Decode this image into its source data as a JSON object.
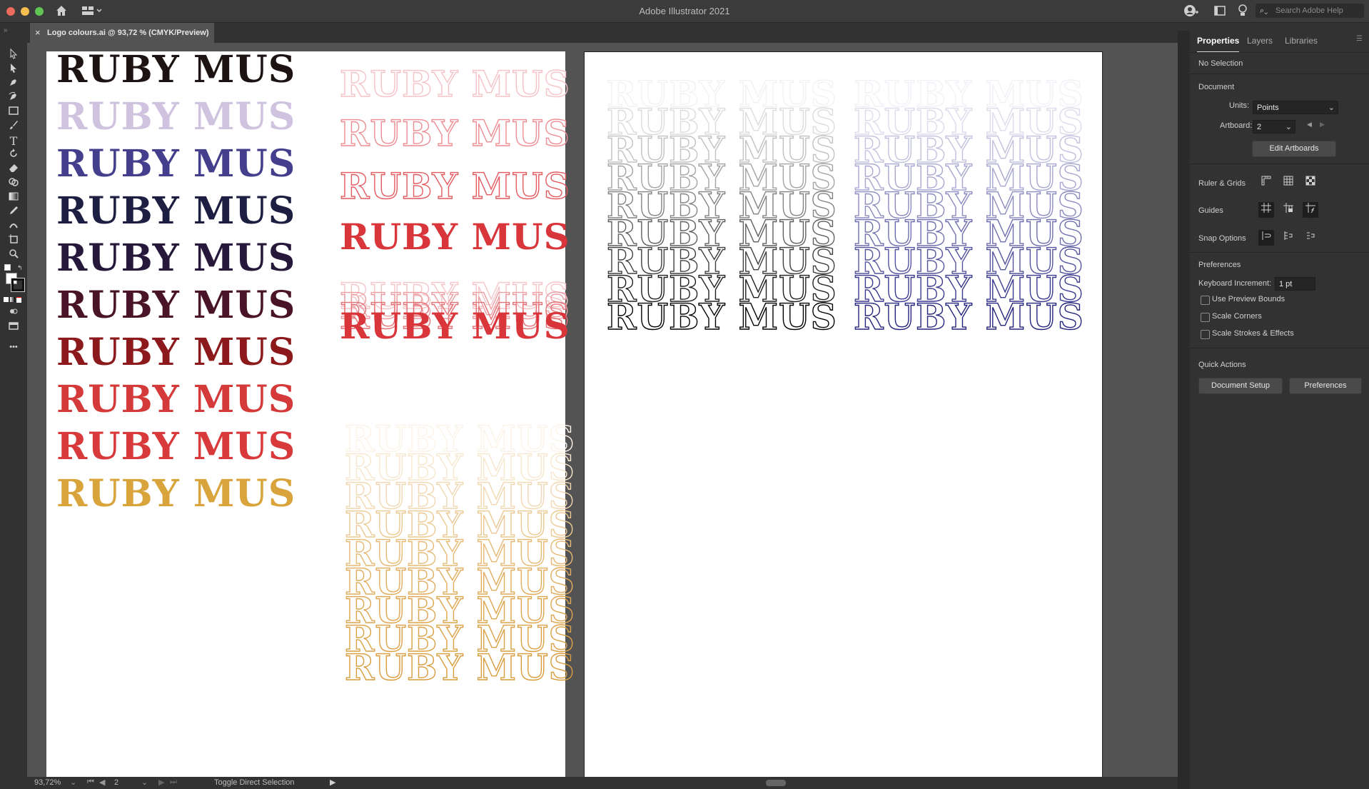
{
  "window": {
    "title": "Adobe Illustrator 2021",
    "search_placeholder": "Search Adobe Help"
  },
  "document_tab": {
    "label": "Logo colours.ai @ 93,72 % (CMYK/Preview)",
    "close_glyph": "×"
  },
  "toolbar": {
    "tools": [
      "selection-tool",
      "direct-selection-tool",
      "pen-tool",
      "curvature-tool",
      "rectangle-tool",
      "paintbrush-tool",
      "type-tool",
      "rotate-tool",
      "eraser-tool",
      "shape-builder-tool",
      "gradient-tool",
      "eyedropper-tool",
      "puppet-warp-tool",
      "artboard-tool",
      "zoom-tool"
    ],
    "more_glyph": "•••"
  },
  "artwork": {
    "text": "RUBY MUS",
    "left_column_colors": [
      "#1c1312",
      "#cfc3df",
      "#443f8c",
      "#1d1f42",
      "#26183b",
      "#4a1428",
      "#8c1a1c",
      "#d53a3a",
      "#d83a3c",
      "#d8a43b"
    ],
    "red_column_colors": [
      "#f5c3c7",
      "#ec8e93",
      "#e35a5f",
      "#d8363b"
    ],
    "red_stack_colors": [
      "#f4c6c9",
      "#ec9ea2",
      "#e47176",
      "#d8363b"
    ],
    "gold_stack_colors": [
      "#fbf3e7",
      "#f7e7cf",
      "#f1d8b2",
      "#ecc992",
      "#e6b975",
      "#e1ac5d",
      "#dea54f",
      "#dba146",
      "#d89c3d"
    ],
    "black_stack_colors": [
      "#f2f2f2",
      "#dcdcdc",
      "#c2c2c2",
      "#a4a4a4",
      "#848484",
      "#616161",
      "#404040",
      "#202020",
      "#000000"
    ],
    "navy_stack_colors": [
      "#f1f1f7",
      "#dcdcec",
      "#c2c2de",
      "#a7a7cf",
      "#8c8cc0",
      "#7070b0",
      "#55559f",
      "#3a3a8f",
      "#25257d"
    ]
  },
  "status_bar": {
    "zoom": "93,72%",
    "artboard_number": "2",
    "tool_hint": "Toggle Direct Selection"
  },
  "panel": {
    "tabs": [
      "Properties",
      "Layers",
      "Libraries"
    ],
    "selection_status": "No Selection",
    "document_label": "Document",
    "units_label": "Units:",
    "units_value": "Points",
    "artboard_label": "Artboard:",
    "artboard_value": "2",
    "edit_artboards": "Edit Artboards",
    "ruler_grids": "Ruler & Grids",
    "guides": "Guides",
    "snap_options": "Snap Options",
    "preferences_label": "Preferences",
    "keyboard_increment_label": "Keyboard Increment:",
    "keyboard_increment_value": "1 pt",
    "use_preview_bounds": "Use Preview Bounds",
    "scale_corners": "Scale Corners",
    "scale_strokes": "Scale Strokes & Effects",
    "quick_actions": "Quick Actions",
    "document_setup": "Document Setup",
    "preferences_button": "Preferences"
  }
}
